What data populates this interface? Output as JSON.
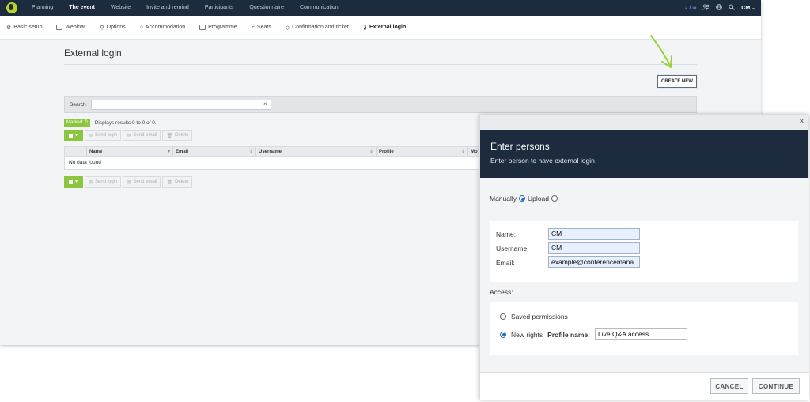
{
  "topnav": {
    "items": [
      "Planning",
      "The event",
      "Website",
      "Invite and remind",
      "Participants",
      "Questionnaire",
      "Communication"
    ],
    "active_index": 1,
    "count": "2 / ∞",
    "user": "CM"
  },
  "subnav": {
    "items": [
      "Basic setup",
      "Webinar",
      "Options",
      "Accommodation",
      "Programme",
      "Seats",
      "Confirmation and ticket",
      "External login"
    ],
    "active_index": 7
  },
  "page": {
    "title": "External login",
    "create_button": "CREATE NEW",
    "search_label": "Search",
    "search_value": "",
    "marked_badge": "Marked: 0",
    "results_text": "Displays results 0 to 0 of 0.",
    "toolbar": {
      "send_login": "Send login",
      "send_email": "Send email",
      "delete": "Delete"
    },
    "table": {
      "columns": [
        "Name",
        "Email",
        "Username",
        "Profile",
        "Mo"
      ],
      "empty_text": "No data found"
    }
  },
  "dialog": {
    "title": "Enter persons",
    "subtitle": "Enter person to have external login",
    "mode_manual": "Manually",
    "mode_upload": "Upload",
    "selected_mode": "Manually",
    "fields": {
      "name_label": "Name:",
      "name_value": "CM",
      "username_label": "Username:",
      "username_value": "CM",
      "email_label": "Email:",
      "email_value": "example@conferencemana"
    },
    "access_label": "Access:",
    "saved_permissions": "Saved permissions",
    "new_rights": "New rights",
    "selected_access": "New rights",
    "profile_name_label": "Profile name:",
    "profile_name_value": "Live Q&A access",
    "cancel": "CANCEL",
    "continue": "CONTINUE"
  },
  "colors": {
    "topbar": "#1c2b3e",
    "accent_green": "#8cc63f",
    "arrow": "#9bd13a",
    "radio": "#2a6ac8"
  }
}
